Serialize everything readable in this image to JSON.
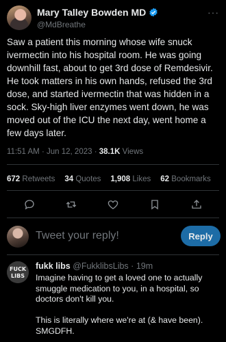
{
  "tweet": {
    "author_name": "Mary Talley Bowden MD",
    "handle": "@MdBreathe",
    "more_icon": "···",
    "text": "Saw a patient this morning whose wife snuck ivermectin into his hospital room. He was going downhill fast, about to get 3rd dose of Remdesivir. He took matters in his own hands, refused the 3rd dose, and started ivermectin that was hidden in a sock. Sky-high liver enzymes went down, he was moved out of the ICU the next day, went home a few days later.",
    "time": "11:51 AM",
    "date": "Jun 12, 2023",
    "separator": "·",
    "views_count": "38.1K",
    "views_label": "Views",
    "verified_color": "#1d9bf0"
  },
  "stats": {
    "retweets_count": "672",
    "retweets_label": "Retweets",
    "quotes_count": "34",
    "quotes_label": "Quotes",
    "likes_count": "1,908",
    "likes_label": "Likes",
    "bookmarks_count": "62",
    "bookmarks_label": "Bookmarks"
  },
  "actions": [
    "reply-icon",
    "retweet-icon",
    "like-icon",
    "bookmark-icon",
    "share-icon"
  ],
  "composer": {
    "placeholder": "Tweet your reply!",
    "button_label": "Reply",
    "button_color": "#1d6ca6"
  },
  "reply": {
    "name": "fukk libs",
    "handle": "@FukklibsLibs",
    "separator": "·",
    "time": "19m",
    "text_p1": "Imagine having to get a loved one to actually smuggle medication to you, in a hospital, so doctors don't kill you.",
    "text_p2": "This is literally where we're at (& have been). SMGDFH.",
    "avatar_text_top": "FUCK",
    "avatar_text_bottom": "LIBS"
  }
}
